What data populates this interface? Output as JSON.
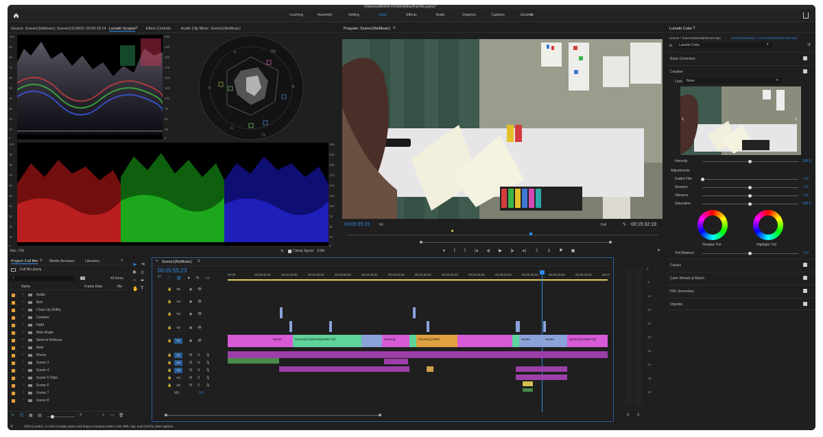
{
  "title_bar": {
    "path": "/Volumes/ADATA HV300/Wither/Full film.prproj *"
  },
  "workspaces": [
    "Learning",
    "Assembly",
    "Editing",
    "Color",
    "Effects",
    "Audio",
    "Graphics",
    "Captions",
    "Libraries"
  ],
  "workspace_active": "Color",
  "scopes_panel": {
    "source_tab": "Source: Scene1(NoMusic): Scene1(1).MOV: 00:06:18:14",
    "tabs": [
      "Lumetri Scopes",
      "Effect Controls",
      "Audio Clip Mixer: Scene1(NoMusic)"
    ],
    "left_ticks": [
      "100",
      "90",
      "80",
      "70",
      "60",
      "50",
      "40",
      "30",
      "20",
      "10",
      "0"
    ],
    "right_ticks": [
      "255",
      "230",
      "204",
      "178",
      "153",
      "128",
      "102",
      "76",
      "51",
      "26",
      "0"
    ],
    "bottom_left_ticks": [
      "100",
      "90",
      "80",
      "70",
      "60",
      "50",
      "40",
      "30",
      "20",
      "10",
      "0"
    ],
    "bottom_right_ticks": [
      "255",
      "230",
      "204",
      "178",
      "153",
      "128",
      "102",
      "76",
      "51",
      "26",
      "0"
    ],
    "rec_label": "Rec. 709",
    "clamp_label": "Clamp Signal",
    "bit_label": "8 Bit",
    "vector_labels": [
      "R",
      "Mg",
      "B",
      "Cy",
      "G",
      "Yl"
    ]
  },
  "program": {
    "title": "Program: Scene1(NoMusic)",
    "timecode": "00:05:55:23",
    "fit": "Fit",
    "full": "Full",
    "duration": "00:15:32:19"
  },
  "project": {
    "tabs": [
      "Project: Full film",
      "Media Browser",
      "Libraries"
    ],
    "file": "Full film.prproj",
    "items_count": "43 items",
    "col_name": "Name",
    "col_frame_rate": "Frame Rate",
    "col_media": "Me",
    "items": [
      "Audio",
      "Bed",
      "Close Up (Gifts)",
      "Curtains",
      "Fight",
      "Main Angle",
      "Need to Refocus",
      "Note",
      "Phone",
      "Scene 3",
      "Scene 4",
      "Scene 5 Clips",
      "Scene 6",
      "Scene 7",
      "Scene 8"
    ]
  },
  "timeline": {
    "tab": "Scene1(NoMusic)",
    "timecode": "00:05:55:23",
    "ruler": [
      "00:00",
      "00:00:30:00",
      "00:01:00:00",
      "00:01:30:00",
      "00:02:00:00",
      "00:02:30:00",
      "00:03:00:00",
      "00:03:30:00",
      "00:04:00:00",
      "00:04:30:00",
      "00:05:00:00",
      "00:05:30:00",
      "00:06:00:00",
      "00:06:30:00",
      "00:07"
    ],
    "video_tracks": [
      "V5",
      "V4",
      "V3",
      "V2",
      "V1"
    ],
    "audio_tracks": [
      "A1",
      "A2",
      "A3",
      "A4",
      "A5"
    ],
    "mix": "Mix",
    "mix_val": "0.0",
    "clip_labels": [
      "Scene",
      "Scene1(Col(Scene)).MOV [V]",
      "Scene1[",
      "Scene1(1).MOV",
      "Scene",
      "Scene",
      "Scene1(1).MOV [V]",
      "Scene1(1)MOV [V]"
    ],
    "meter_ticks": [
      "0",
      "-6",
      "-12",
      "-18",
      "-24",
      "-30",
      "-36",
      "-42",
      "-48",
      "-54"
    ],
    "meter_bottom": [
      "S",
      "S"
    ]
  },
  "lumetri": {
    "title": "Lumetri Color",
    "source": "Source * Scene1NoSortachCard.mp4",
    "sequence": "Scene1(NoMusic) * Scene1NoSortachCard.mp4",
    "fx": "fx",
    "fx_name": "Lumetri Color",
    "sections": [
      "Basic Correction",
      "Creative",
      "Curves",
      "Color Wheels & Match",
      "HSL Secondary",
      "Vignette"
    ],
    "look_label": "Look",
    "look_value": "None",
    "intensity_label": "Intensity",
    "intensity_value": "100.0",
    "adjustments_label": "Adjustments",
    "adjustments": [
      {
        "label": "Faded Film",
        "value": "0.0"
      },
      {
        "label": "Sharpen",
        "value": "0.0"
      },
      {
        "label": "Vibrance",
        "value": "0.0"
      },
      {
        "label": "Saturation",
        "value": "100.0"
      }
    ],
    "shadow_tint": "Shadow Tint",
    "highlight_tint": "Highlight Tint",
    "tint_balance": "Tint Balance",
    "tint_balance_value": "0.0"
  },
  "status": {
    "text": "Click to select, or click in empty space and drag to marquee select. Use Shift, Opt, and Cmd for other options."
  },
  "colors": {
    "accent": "#2d8ceb",
    "v1_clip": "#d75ad7",
    "v1_clip2": "#5ed49a",
    "audio_clip": "#9c3fa8"
  }
}
